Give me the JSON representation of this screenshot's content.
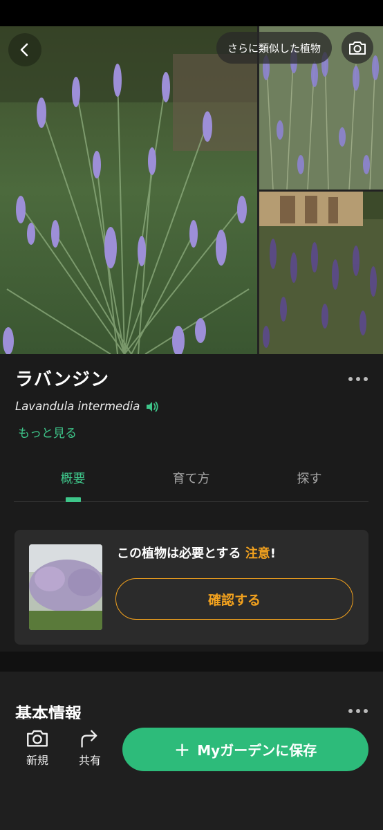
{
  "header": {
    "similar_plants_label": "さらに類似した植物"
  },
  "plant": {
    "common_name": "ラバンジン",
    "scientific_name": "Lavandula intermedia",
    "more_link": "もっと見る"
  },
  "tabs": [
    {
      "label": "概要",
      "active": true
    },
    {
      "label": "育て方",
      "active": false
    },
    {
      "label": "探す",
      "active": false
    }
  ],
  "attention_card": {
    "text_prefix": "この植物は必要とする",
    "text_accent": "注意",
    "text_suffix": "!",
    "confirm_button": "確認する"
  },
  "section": {
    "title": "基本情報"
  },
  "bottom_bar": {
    "new_label": "新規",
    "share_label": "共有",
    "save_button": "Myガーデンに保存"
  },
  "colors": {
    "accent_green": "#3ec68a",
    "save_green": "#2dbb7a",
    "warning_orange": "#f3a21e",
    "background": "#1b1b1b"
  },
  "icons": [
    "back-arrow-icon",
    "camera-icon",
    "speaker-icon",
    "more-icon",
    "share-icon",
    "plus-icon"
  ]
}
